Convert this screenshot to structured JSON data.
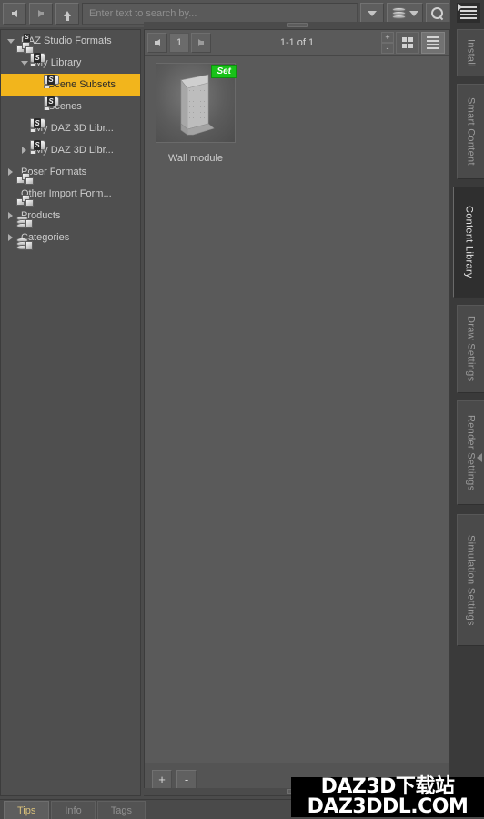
{
  "toolbar": {
    "back_label": "Back",
    "forward_label": "Forward",
    "up_label": "Up",
    "search_placeholder": "Enter text to search by...",
    "search_value": "",
    "filter_dropdown_label": "Filter",
    "database_label": "Database",
    "database_dropdown_label": "Database options",
    "search_button_label": "Search"
  },
  "tree": {
    "items": [
      {
        "label": "DAZ Studio Formats",
        "icon": "boxes-s-icon",
        "indent": 0,
        "twisty": "open",
        "selected": false
      },
      {
        "label": "My Library",
        "icon": "folder-s-icon",
        "indent": 1,
        "twisty": "open",
        "selected": false
      },
      {
        "label": "Scene Subsets",
        "icon": "folder-s-icon",
        "indent": 2,
        "twisty": "none",
        "selected": true
      },
      {
        "label": "Scenes",
        "icon": "folder-s-icon",
        "indent": 2,
        "twisty": "none",
        "selected": false
      },
      {
        "label": "My DAZ 3D Libr...",
        "icon": "folder-s-icon",
        "indent": 1,
        "twisty": "none",
        "selected": false
      },
      {
        "label": "My DAZ 3D Libr...",
        "icon": "folder-s-icon",
        "indent": 1,
        "twisty": "closed",
        "selected": false
      },
      {
        "label": "Poser Formats",
        "icon": "boxes-icon",
        "indent": 0,
        "twisty": "closed",
        "selected": false
      },
      {
        "label": "Other Import Form...",
        "icon": "boxes-icon",
        "indent": 0,
        "twisty": "none",
        "selected": false
      },
      {
        "label": "Products",
        "icon": "cylinder-icon",
        "indent": 0,
        "twisty": "closed",
        "selected": false
      },
      {
        "label": "Categories",
        "icon": "cylinder-icon",
        "indent": 0,
        "twisty": "closed",
        "selected": false
      }
    ]
  },
  "content": {
    "page_prev_label": "Previous page",
    "page_number": "1",
    "page_next_label": "Next page",
    "count_label": "1-1 of 1",
    "zoom_in_label": "+",
    "zoom_out_label": "-",
    "grid_view_label": "Grid view",
    "list_view_label": "List view",
    "assets": [
      {
        "name": "Wall module",
        "badge": "Set",
        "badge_color": "#19c219"
      }
    ],
    "add_label": "+",
    "remove_label": "-"
  },
  "vertical_tabs": {
    "panel_menu_label": "Panel options",
    "items": [
      {
        "label": "Install",
        "active": false
      },
      {
        "label": "Smart Content",
        "active": false
      },
      {
        "label": "Content Library",
        "active": true
      },
      {
        "label": "Draw Settings",
        "active": false
      },
      {
        "label": "Render Settings",
        "active": false
      },
      {
        "label": "Simulation Settings",
        "active": false
      }
    ]
  },
  "bottom_tabs": {
    "items": [
      {
        "label": "Tips",
        "active": true
      },
      {
        "label": "Info",
        "active": false
      },
      {
        "label": "Tags",
        "active": false
      }
    ]
  },
  "watermark": {
    "line1": "DAZ3D下载站",
    "line2": "DAZ3DDL.COM"
  },
  "colors": {
    "selection": "#f2b51c",
    "badge_green": "#19c219",
    "panel_bg": "#4f4f4f",
    "toolbar_bg": "#555555",
    "active_tab_text": "#d9c07a"
  }
}
